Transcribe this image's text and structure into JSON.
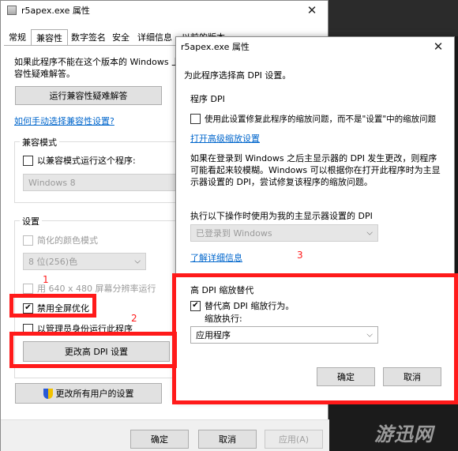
{
  "back_window": {
    "title": "r5apex.exe 属性",
    "tabs": [
      "常规",
      "兼容性",
      "数字签名",
      "安全",
      "详细信息",
      "以前的版本"
    ],
    "intro_line1": "如果此程序不能在这个版本的 Windows 上",
    "intro_line2": "容性疑难解答。",
    "troubleshoot_button": "运行兼容性疑难解答",
    "manual_link": "如何手动选择兼容性设置?",
    "compat_mode_group": "兼容模式",
    "compat_mode_checkbox": "以兼容模式运行这个程序:",
    "compat_mode_select": "Windows 8",
    "settings_group": "设置",
    "reduced_color": "简化的颜色模式",
    "color_select": "8 位(256)色",
    "run_640": "用 640 x 480 屏幕分辨率运行",
    "disable_fullscreen": "禁用全屏优化",
    "run_admin": "以管理员身份运行此程序",
    "dpi_button": "更改高 DPI 设置",
    "all_users_button": "更改所有用户的设置",
    "ok": "确定",
    "cancel": "取消",
    "apply": "应用(A)"
  },
  "front_dialog": {
    "title": "r5apex.exe 属性",
    "header": "为此程序选择高 DPI 设置。",
    "program_dpi_group": "程序 DPI",
    "program_dpi_checkbox": "使用此设置修复此程序的缩放问题，而不是\"设置\"中的缩放问题",
    "open_advanced_link": "打开高级缩放设置",
    "description_line1": "如果在登录到 Windows 之后主显示器的 DPI 发生更改，则程序",
    "description_line2": "可能看起来较模糊。Windows 可以根据你在打开此程序时为主显",
    "description_line3": "示器设置的 DPI，尝试修复该程序的缩放问题。",
    "execute_label": "执行以下操作时使用为我的主显示器设置的 DPI",
    "login_select": "已登录到 Windows",
    "learn_more_link": "了解详细信息",
    "override_group": "高 DPI 缩放替代",
    "override_checkbox": "替代高 DPI 缩放行为。",
    "scaling_label": "缩放执行:",
    "scaling_select": "应用程序",
    "ok": "确定",
    "cancel": "取消"
  },
  "annotations": {
    "one": "1",
    "two": "2",
    "three": "3"
  },
  "watermark": "游迅网",
  "colors": {
    "annotation_red": "#ff1a1a",
    "link_blue": "#0066cc"
  }
}
